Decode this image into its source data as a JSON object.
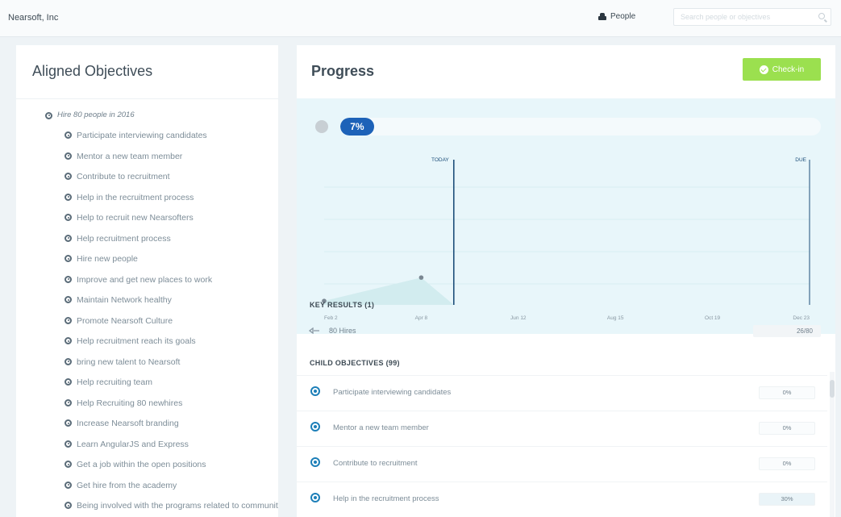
{
  "header": {
    "company": "Nearsoft, Inc",
    "people_label": "People",
    "search_placeholder": "Search people or objectives"
  },
  "left": {
    "title": "Aligned Objectives",
    "root": "Hire 80 people in 2016",
    "items": [
      "Participate interviewing candidates",
      "Mentor a new team member",
      "Contribute to recruitment",
      "Help in the recruitment process",
      "Help to recruit new Nearsofters",
      "Help recruitment process",
      "Hire new people",
      "Improve and get new places to work",
      "Maintain Network healthy",
      "Promote Nearsoft Culture",
      "Help recruitment reach its goals",
      "bring new talent to Nearsoft",
      "Help recruiting team",
      "Help Recruiting 80 newhires",
      "Increase Nearsoft branding",
      "Learn AngularJS and Express",
      "Get a job within the open positions",
      "Get hire from the academy",
      "Being involved with the programs related to community attract talent"
    ]
  },
  "right": {
    "title": "Progress",
    "checkin_label": "Check-in",
    "progress_pct": 7,
    "progress_label": "7%",
    "key_results_header": "KEY RESULTS (1)",
    "key_result": {
      "label": "80 Hires",
      "value": "26/80"
    },
    "child_header": "CHILD OBJECTIVES (99)",
    "children": [
      {
        "label": "Participate interviewing candidates",
        "pct": "0%"
      },
      {
        "label": "Mentor a new team member",
        "pct": "0%"
      },
      {
        "label": "Contribute to recruitment",
        "pct": "0%"
      },
      {
        "label": "Help in the recruitment process",
        "pct": "30%"
      }
    ]
  },
  "chart_data": {
    "type": "area",
    "x_ticks": [
      "Feb 2",
      "Apr 8",
      "Jun 12",
      "Aug 15",
      "Oct 19",
      "Dec 23"
    ],
    "markers": [
      {
        "label": "TODAY",
        "x": "Apr 28"
      },
      {
        "label": "DUE",
        "x": "Dec 23"
      }
    ],
    "points": [
      {
        "x": "Feb 2",
        "y": 1
      },
      {
        "x": "Apr 8",
        "y": 7
      }
    ],
    "colors": {
      "fill": "#d2ecef",
      "marker": "#1d4f7a",
      "point": "#7a8792"
    }
  }
}
